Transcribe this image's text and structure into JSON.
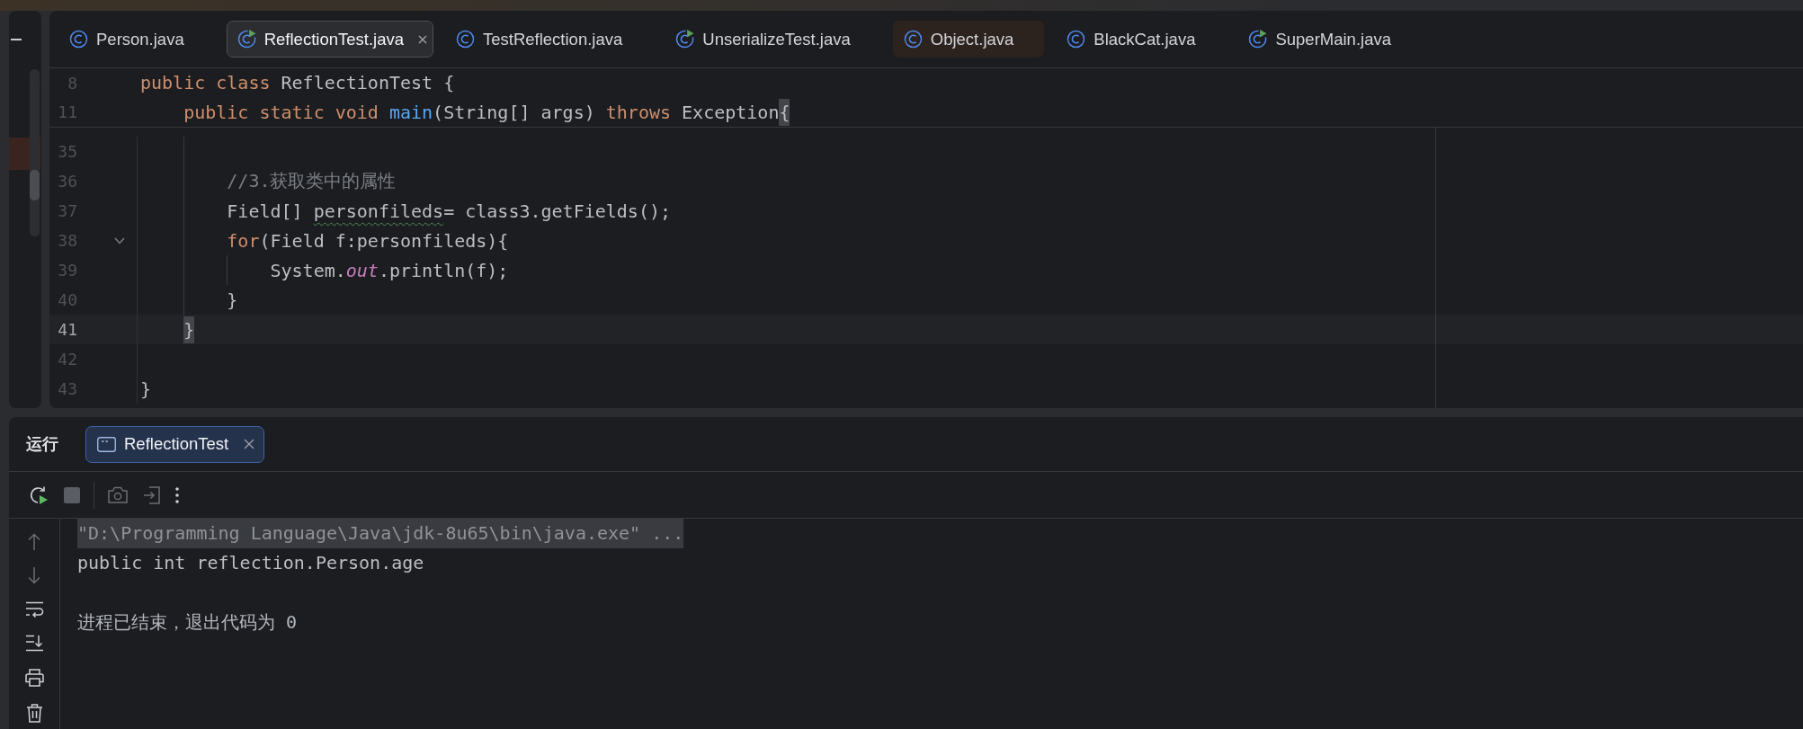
{
  "editor": {
    "tabs": [
      {
        "label": "Person.java",
        "kind": "class",
        "selected": false,
        "library": false
      },
      {
        "label": "ReflectionTest.java",
        "kind": "runnable",
        "selected": true,
        "library": false
      },
      {
        "label": "TestReflection.java",
        "kind": "class",
        "selected": false,
        "library": false
      },
      {
        "label": "UnserializeTest.java",
        "kind": "runnable",
        "selected": false,
        "library": false
      },
      {
        "label": "Object.java",
        "kind": "class",
        "selected": false,
        "library": true
      },
      {
        "label": "BlackCat.java",
        "kind": "class",
        "selected": false,
        "library": false
      },
      {
        "label": "SuperMain.java",
        "kind": "runnable",
        "selected": false,
        "library": false
      }
    ],
    "code": [
      {
        "number": "8",
        "sticky": true,
        "current": false,
        "fold": false,
        "tokens": [
          {
            "text": "public class",
            "kind": "keyword"
          },
          {
            "text": " ReflectionTest {",
            "kind": "plain"
          }
        ],
        "children": [
          {
            "number": "11",
            "sticky": true,
            "current": false,
            "fold": false,
            "tokens": [
              {
                "text": "public static void ",
                "kind": "keyword"
              },
              {
                "text": "main",
                "kind": "method"
              },
              {
                "text": "(String[] args) ",
                "kind": "plain"
              },
              {
                "text": "throws",
                "kind": "keyword"
              },
              {
                "text": " Exception",
                "kind": "plain"
              },
              {
                "text": "{",
                "kind": "brace_match"
              }
            ],
            "children": [
              {
                "number": "35",
                "sticky": false,
                "current": false,
                "fold": false
              },
              {
                "number": "36",
                "sticky": false,
                "current": false,
                "fold": false,
                "tokens": [
                  {
                    "text": "//3.获取类中的属性",
                    "kind": "comment"
                  }
                ]
              },
              {
                "number": "37",
                "sticky": false,
                "current": false,
                "fold": false,
                "tokens": [
                  {
                    "text": "Field[] ",
                    "kind": "plain"
                  },
                  {
                    "text": "personfileds",
                    "kind": "typo"
                  },
                  {
                    "text": "= class3.getFields();",
                    "kind": "plain"
                  }
                ]
              },
              {
                "number": "38",
                "sticky": false,
                "current": false,
                "fold": true,
                "tokens": [
                  {
                    "text": "for",
                    "kind": "keyword"
                  },
                  {
                    "text": "(Field f:personfileds){",
                    "kind": "plain"
                  }
                ],
                "children": [
                  {
                    "number": "39",
                    "sticky": false,
                    "current": false,
                    "fold": false,
                    "tokens": [
                      {
                        "text": "System.",
                        "kind": "plain"
                      },
                      {
                        "text": "out",
                        "kind": "static_field"
                      },
                      {
                        "text": ".println(f);",
                        "kind": "plain"
                      }
                    ]
                  }
                ]
              },
              {
                "number": "40",
                "sticky": false,
                "current": false,
                "fold": false,
                "tokens": [
                  {
                    "text": "}",
                    "kind": "plain"
                  }
                ]
              }
            ]
          },
          {
            "number": "41",
            "sticky": false,
            "current": true,
            "fold": false,
            "tokens": [
              {
                "text": "}",
                "kind": "brace_match"
              }
            ]
          },
          {
            "number": "42",
            "sticky": false,
            "current": false,
            "fold": false
          }
        ]
      },
      {
        "number": "43",
        "sticky": false,
        "current": false,
        "fold": false,
        "tokens": [
          {
            "text": "}",
            "kind": "plain"
          }
        ]
      }
    ]
  },
  "run_panel": {
    "title": "运行",
    "tabs": [
      {
        "label": "ReflectionTest",
        "selected": true
      }
    ],
    "run_controls": [
      {
        "kind": "rerun",
        "disabled": false
      },
      {
        "kind": "stop",
        "disabled": true
      }
    ],
    "actions": [
      {
        "kind": "screenshot",
        "disabled": true
      },
      {
        "kind": "attach",
        "disabled": true
      },
      {
        "kind": "more",
        "disabled": false
      }
    ],
    "side_actions": [
      {
        "kind": "up",
        "disabled": true
      },
      {
        "kind": "down",
        "disabled": true
      },
      {
        "kind": "wrap",
        "disabled": false
      },
      {
        "kind": "scroll_end",
        "disabled": false
      },
      {
        "kind": "print",
        "disabled": false
      },
      {
        "kind": "trash",
        "disabled": false
      }
    ],
    "console": [
      {
        "text": "\"D:\\Programming Language\\Java\\jdk-8u65\\bin\\java.exe\" ...",
        "kind": "command"
      },
      {
        "text": "public int reflection.Person.age",
        "kind": "output"
      },
      {
        "text": "进程已结束，退出代码为 0",
        "kind": "exit"
      }
    ]
  }
}
